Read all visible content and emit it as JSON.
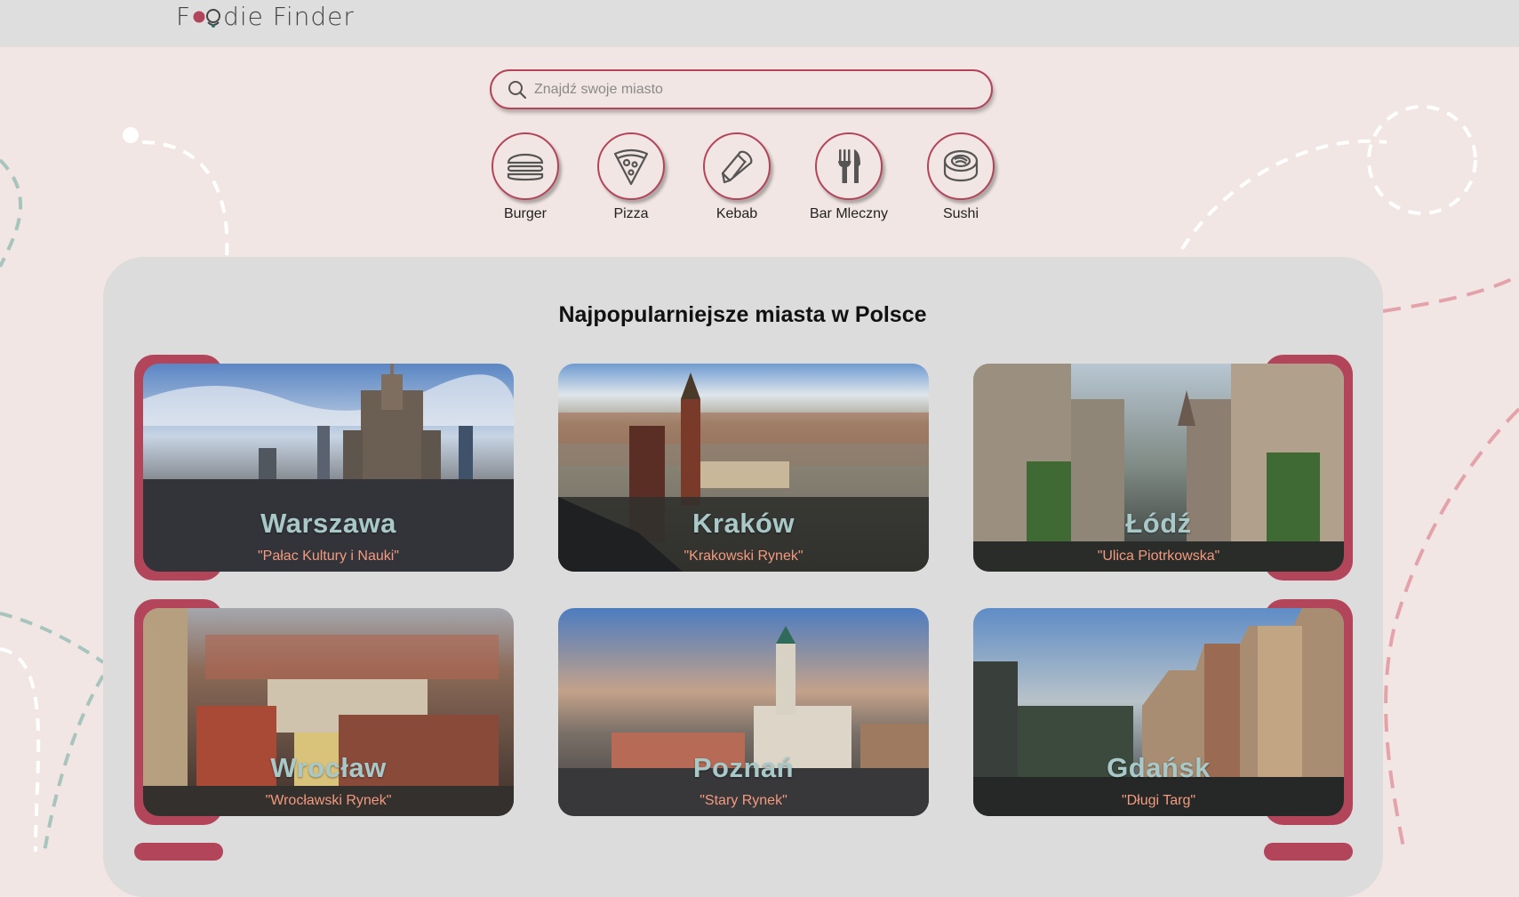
{
  "header": {
    "logo_text_start": "F",
    "logo_text_end": "die Finder"
  },
  "search": {
    "placeholder": "Znajdź swoje miasto"
  },
  "categories": [
    {
      "label": "Burger",
      "icon": "burger-icon"
    },
    {
      "label": "Pizza",
      "icon": "pizza-icon"
    },
    {
      "label": "Kebab",
      "icon": "kebab-icon"
    },
    {
      "label": "Bar Mleczny",
      "icon": "fork-knife-icon"
    },
    {
      "label": "Sushi",
      "icon": "sushi-icon"
    }
  ],
  "section": {
    "title": "Najpopularniejsze miasta w Polsce"
  },
  "cities": [
    {
      "name": "Warszawa",
      "landmark": "\"Pałac Kultury i Nauki\""
    },
    {
      "name": "Kraków",
      "landmark": "\"Krakowski Rynek\""
    },
    {
      "name": "Łódź",
      "landmark": "\"Ulica Piotrkowska\""
    },
    {
      "name": "Wrocław",
      "landmark": "\"Wrocławski Rynek\""
    },
    {
      "name": "Poznań",
      "landmark": "\"Stary Rynek\""
    },
    {
      "name": "Gdańsk",
      "landmark": "\"Długi Targ\""
    }
  ],
  "colors": {
    "accent": "#b3455a",
    "background": "#f1e6e3",
    "panel": "#dcdcdc",
    "city_name": "#a9c8c8",
    "landmark": "#f39a7f"
  }
}
